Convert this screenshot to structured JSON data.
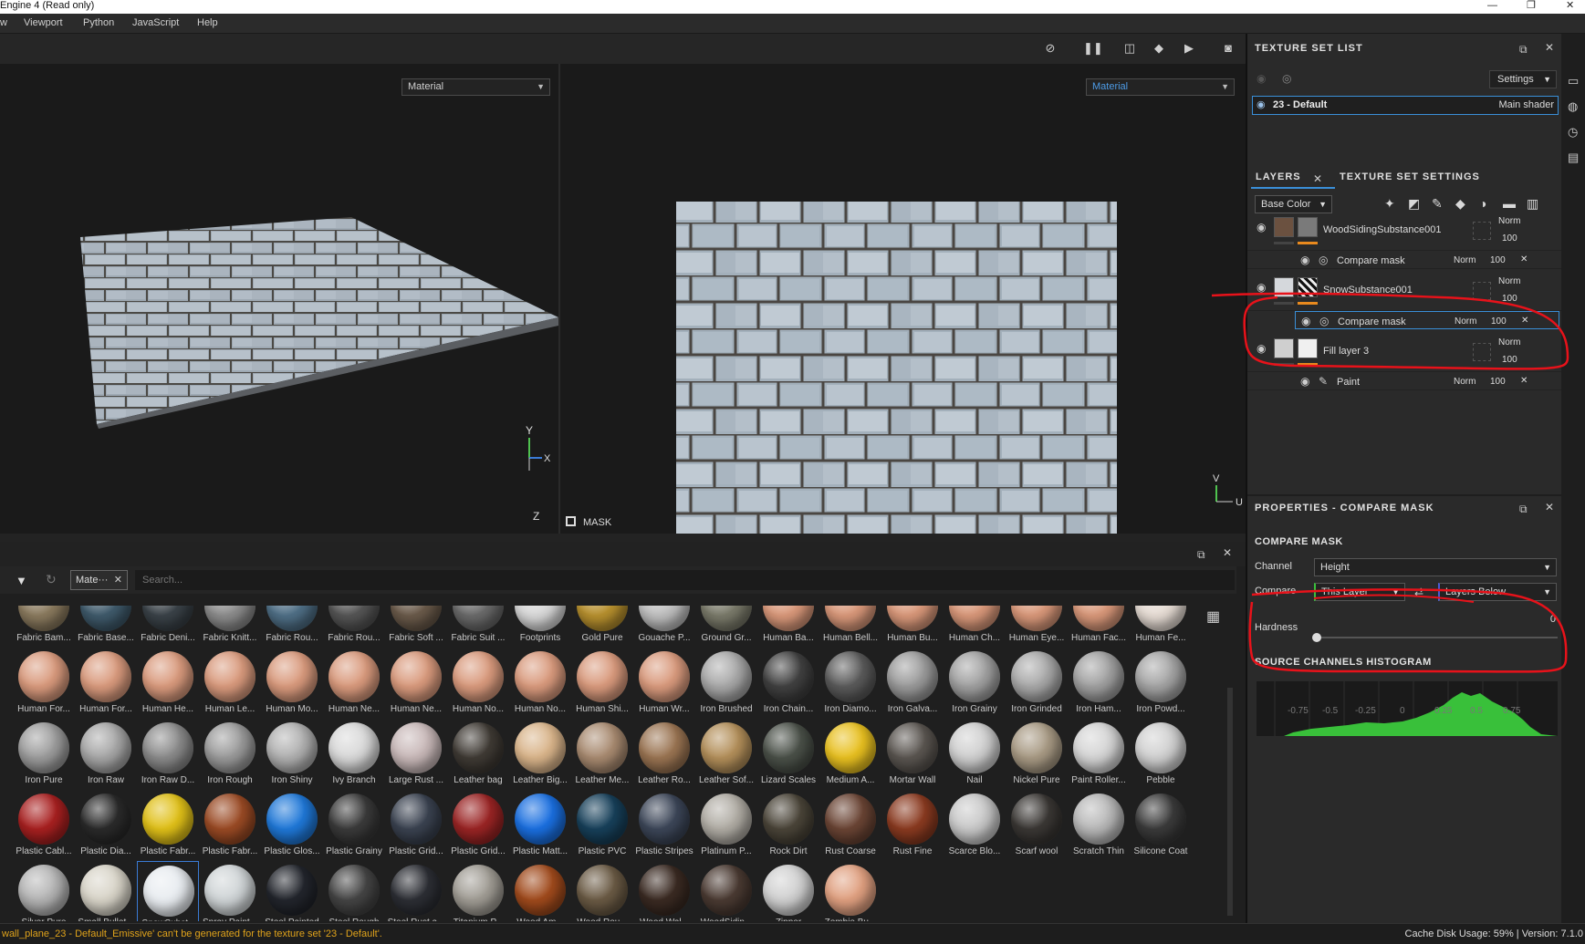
{
  "window": {
    "title": "Engine 4 (Read only)",
    "controls": [
      "—",
      "❐",
      "✕"
    ]
  },
  "menu": [
    "w",
    "Viewport",
    "Python",
    "JavaScript",
    "Help"
  ],
  "viewport": {
    "left_mode": "Material",
    "right_mode": "Material",
    "axis_left_y": "Y",
    "axis_left_x": "X",
    "axis_left_z": "Z",
    "axis_right_v": "V",
    "axis_right_u": "U",
    "mask_label": "MASK"
  },
  "shelf": {
    "filter_chip": "Mate···",
    "search_placeholder": "Search...",
    "rows": [
      [
        {
          "name": "Fabric Bam...",
          "color": "#8a7a5e"
        },
        {
          "name": "Fabric Base...",
          "color": "#3f5a6b"
        },
        {
          "name": "Fabric Deni...",
          "color": "#3a4248"
        },
        {
          "name": "Fabric Knitt...",
          "color": "#8c8c8c"
        },
        {
          "name": "Fabric Rou...",
          "color": "#4f6f86"
        },
        {
          "name": "Fabric Rou...",
          "color": "#555555"
        },
        {
          "name": "Fabric Soft ...",
          "color": "#6a5a4a"
        },
        {
          "name": "Fabric Suit ...",
          "color": "#6a6a6a"
        },
        {
          "name": "Footprints",
          "color": "#d8d8d8"
        },
        {
          "name": "Gold Pure",
          "color": "#b7902e"
        },
        {
          "name": "Gouache P...",
          "color": "#bfbfbf"
        },
        {
          "name": "Ground Gr...",
          "color": "#7a7a6a"
        },
        {
          "name": "Human Ba...",
          "color": "#d9987a"
        },
        {
          "name": "Human Bell...",
          "color": "#d9987a"
        },
        {
          "name": "Human Bu...",
          "color": "#d9987a"
        },
        {
          "name": "Human Ch...",
          "color": "#d9987a"
        },
        {
          "name": "Human Eye...",
          "color": "#d9987a"
        },
        {
          "name": "Human Fac...",
          "color": "#d9987a"
        },
        {
          "name": "Human Fe...",
          "color": "#e6dcd4"
        }
      ],
      [
        {
          "name": "Human For...",
          "color": "#d99a7d"
        },
        {
          "name": "Human For...",
          "color": "#d99a7d"
        },
        {
          "name": "Human He...",
          "color": "#d99a7d"
        },
        {
          "name": "Human Le...",
          "color": "#d99a7d"
        },
        {
          "name": "Human Mo...",
          "color": "#d99a7d"
        },
        {
          "name": "Human Ne...",
          "color": "#d99a7d"
        },
        {
          "name": "Human Ne...",
          "color": "#d99a7d"
        },
        {
          "name": "Human No...",
          "color": "#d99a7d"
        },
        {
          "name": "Human No...",
          "color": "#d99a7d"
        },
        {
          "name": "Human Shi...",
          "color": "#d99a7d"
        },
        {
          "name": "Human Wr...",
          "color": "#d99a7d"
        },
        {
          "name": "Iron Brushed",
          "color": "#a8a8a8"
        },
        {
          "name": "Iron Chain...",
          "color": "#404040"
        },
        {
          "name": "Iron Diamo...",
          "color": "#5a5a5a"
        },
        {
          "name": "Iron Galva...",
          "color": "#9a9a9a"
        },
        {
          "name": "Iron Grainy",
          "color": "#a0a0a0"
        },
        {
          "name": "Iron Grinded",
          "color": "#a8a8a8"
        },
        {
          "name": "Iron Ham...",
          "color": "#a0a0a0"
        },
        {
          "name": "Iron Powd...",
          "color": "#a4a4a4"
        }
      ],
      [
        {
          "name": "Iron Pure",
          "color": "#9c9c9c"
        },
        {
          "name": "Iron Raw",
          "color": "#a6a6a6"
        },
        {
          "name": "Iron Raw D...",
          "color": "#8a8a8a"
        },
        {
          "name": "Iron Rough",
          "color": "#9a9a9a"
        },
        {
          "name": "Iron Shiny",
          "color": "#b0b0b0"
        },
        {
          "name": "Ivy Branch",
          "color": "#d8d8d8"
        },
        {
          "name": "Large Rust ...",
          "color": "#c8b8b8"
        },
        {
          "name": "Leather bag",
          "color": "#3f3a34"
        },
        {
          "name": "Leather Big...",
          "color": "#d9b48a"
        },
        {
          "name": "Leather Me...",
          "color": "#a88a70"
        },
        {
          "name": "Leather Ro...",
          "color": "#9a7452"
        },
        {
          "name": "Leather Sof...",
          "color": "#b38f5a"
        },
        {
          "name": "Lizard Scales",
          "color": "#4a5048"
        },
        {
          "name": "Medium A...",
          "color": "#e8c020"
        },
        {
          "name": "Mortar Wall",
          "color": "#5a5550"
        },
        {
          "name": "Nail",
          "color": "#cfcfcf"
        },
        {
          "name": "Nickel Pure",
          "color": "#a89a84"
        },
        {
          "name": "Paint Roller...",
          "color": "#d4d4d4"
        },
        {
          "name": "Pebble",
          "color": "#d0d0d0"
        }
      ],
      [
        {
          "name": "Plastic Cabl...",
          "color": "#a82020"
        },
        {
          "name": "Plastic Dia...",
          "color": "#2a2a2a"
        },
        {
          "name": "Plastic Fabr...",
          "color": "#e0c018"
        },
        {
          "name": "Plastic Fabr...",
          "color": "#9a4a24"
        },
        {
          "name": "Plastic Glos...",
          "color": "#1f78d8"
        },
        {
          "name": "Plastic Grainy",
          "color": "#3a3a3a"
        },
        {
          "name": "Plastic Grid...",
          "color": "#3a4250"
        },
        {
          "name": "Plastic Grid...",
          "color": "#9a2424"
        },
        {
          "name": "Plastic Matt...",
          "color": "#1a6fe0"
        },
        {
          "name": "Plastic PVC",
          "color": "#17405a"
        },
        {
          "name": "Plastic Stripes",
          "color": "#3c4658"
        },
        {
          "name": "Platinum P...",
          "color": "#b0aca4"
        },
        {
          "name": "Rock Dirt",
          "color": "#4a4438"
        },
        {
          "name": "Rust Coarse",
          "color": "#6a4434"
        },
        {
          "name": "Rust Fine",
          "color": "#8a3a20"
        },
        {
          "name": "Scarce Blo...",
          "color": "#c8c8c8"
        },
        {
          "name": "Scarf wool",
          "color": "#3a3734"
        },
        {
          "name": "Scratch Thin",
          "color": "#b8b8b8"
        },
        {
          "name": "Silicone Coat",
          "color": "#3a3a3a"
        }
      ],
      [
        {
          "name": "Silver Pure",
          "color": "#b4b4b4"
        },
        {
          "name": "Small Bullet...",
          "color": "#d8d4c8"
        },
        {
          "name": "SnowSubst...",
          "color": "#e8ecf0"
        },
        {
          "name": "Spray Paint...",
          "color": "#cfd4d6"
        },
        {
          "name": "Steel Painted",
          "color": "#22252c"
        },
        {
          "name": "Steel Rough",
          "color": "#444444"
        },
        {
          "name": "Steel Rust a...",
          "color": "#2c2e34"
        },
        {
          "name": "Titanium P...",
          "color": "#a09c94"
        },
        {
          "name": "Wood Am...",
          "color": "#a04a1c"
        },
        {
          "name": "Wood Rou...",
          "color": "#6a5a44"
        },
        {
          "name": "Wood Wal...",
          "color": "#3a2a22"
        },
        {
          "name": "WoodSidin...",
          "color": "#4a3a32"
        },
        {
          "name": "Zipper",
          "color": "#d0d0d0"
        },
        {
          "name": "Zombie Bu...",
          "color": "#e0a080"
        }
      ]
    ]
  },
  "status": {
    "message": "wall_plane_23 - Default_Emissive' can't be generated for the texture set '23 - Default'.",
    "right": "Cache Disk Usage:   59% | Version: 7.1.0"
  },
  "texture_set_list": {
    "title": "TEXTURE SET LIST",
    "settings": "Settings",
    "entry_name": "23 - Default",
    "entry_shader": "Main shader"
  },
  "layers_panel": {
    "tab_layers": "LAYERS",
    "tab_settings": "TEXTURE SET SETTINGS",
    "channel": "Base Color",
    "layers": [
      {
        "name": "WoodSidingSubstance001",
        "blend": "Norm",
        "opacity": "100",
        "sub_name": "Compare mask",
        "sub_blend": "Norm",
        "sub_opacity": "100"
      },
      {
        "name": "SnowSubstance001",
        "blend": "Norm",
        "opacity": "100",
        "sub_name": "Compare mask",
        "sub_blend": "Norm",
        "sub_opacity": "100"
      },
      {
        "name": "Fill layer 3",
        "blend": "Norm",
        "opacity": "100",
        "sub_name": "Paint",
        "sub_blend": "Norm",
        "sub_opacity": "100"
      }
    ]
  },
  "properties": {
    "title": "PROPERTIES - COMPARE MASK",
    "section": "COMPARE MASK",
    "channel_label": "Channel",
    "channel_value": "Height",
    "compare_label": "Compare",
    "compare_a": "This Layer",
    "compare_b": "Layers Below",
    "hardness_label": "Hardness",
    "hardness_value": "0",
    "histogram_title": "SOURCE CHANNELS HISTOGRAM",
    "histogram_ticks": [
      "-0.75",
      "-0.5",
      "-0.25",
      "0",
      "0.25",
      "0.5",
      "0.75"
    ]
  },
  "colors": {
    "accent": "#3a8fd8",
    "opacity_bar": "#e98a1e",
    "annotation": "#e8121a",
    "histogram": "#39c03a"
  }
}
